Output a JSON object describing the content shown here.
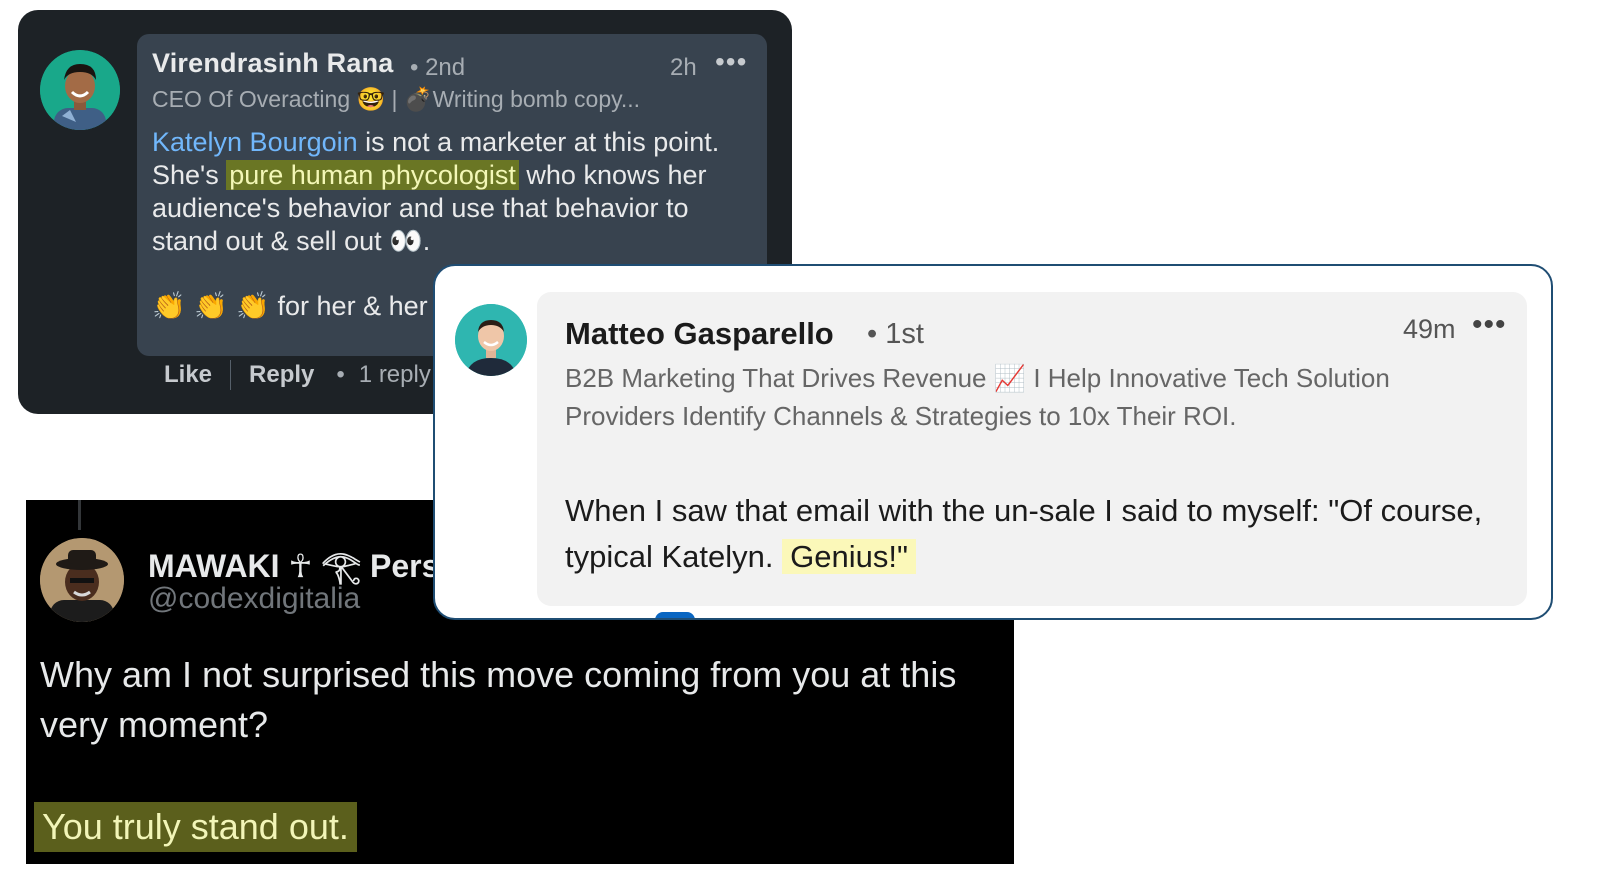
{
  "comment_linkedin_dark": {
    "author_name": "Virendrasinh Rana",
    "connection_degree": "• 2nd",
    "time_ago": "2h",
    "more_icon": "•••",
    "headline_prefix": "CEO Of Overacting",
    "headline_emoji": "🤓",
    "headline_separator": "|",
    "headline_bomb_emoji": "💣",
    "headline_suffix": "Writing bomb copy...",
    "mention": "Katelyn Bourgoin",
    "text_part1": " is not a marketer at this point. She's",
    "highlight": "pure human phycologist",
    "text_part2": " who knows her audience's behavior and use that behavior to stand out & sell out ",
    "eyes_emoji": "👀",
    "text_part3": ".",
    "clap_emojis": "👏 👏 👏",
    "clap_text": " for her & her",
    "like_label": "Like",
    "reply_label": "Reply",
    "dot": "•",
    "reply_count": "1 reply"
  },
  "comment_linkedin_light": {
    "author_name": "Matteo Gasparello",
    "connection_degree": "• 1st",
    "time_ago": "49m",
    "more_icon": "•••",
    "headline_part1": "B2B Marketing That Drives Revenue ",
    "headline_chart_emoji": "📈",
    "headline_part2": " I Help Innovative Tech Solution Providers Identify Channels & Strategies to 10x Their ROI.",
    "text_part1": "When I saw that email with the un-sale I said to myself: \"Of course, typical Katelyn. ",
    "highlight": "Genius!\""
  },
  "reply_x": {
    "author_name": "MAWAKI ☥ 𓂀 Pers",
    "handle": "@codexdigitalia",
    "text": "Why am I not surprised this move coming from you at this very moment?",
    "highlight": "You truly stand out."
  },
  "colors": {
    "linkedin_dark_bg": "#1d2226",
    "linkedin_dark_bubble": "#38434f",
    "mention_blue": "#71b7fb",
    "highlight_green": "#6a7624",
    "highlight_yellow": "#fbf8b9",
    "x_bg": "#000000",
    "card_border": "#1f4d73"
  }
}
